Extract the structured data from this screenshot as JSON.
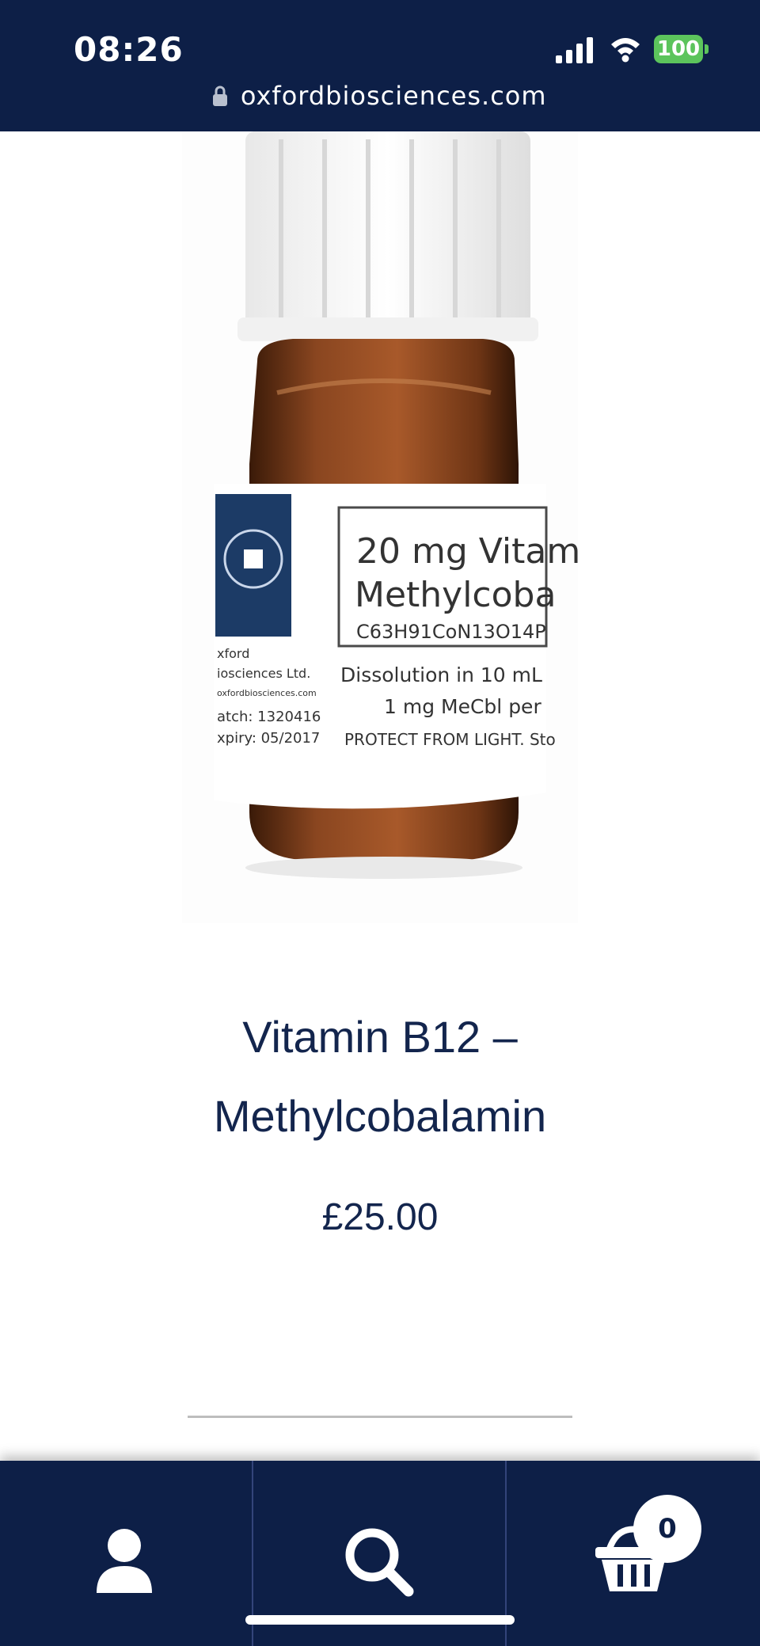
{
  "status_bar": {
    "time": "08:26",
    "battery": "100",
    "url": "oxfordbiosciences.com"
  },
  "product": {
    "title_line1": "Vitamin B12 –",
    "title_line2": "Methylcobalamin",
    "price": "£25.00",
    "image": {
      "label_line1": "20 mg Vitam",
      "label_line2": "Methylcoba",
      "formula": "C63H91CoN13O14P",
      "dissolution": "Dissolution in 10 mL",
      "concentration": "1 mg MeCbl per",
      "warning": "PROTECT FROM LIGHT. Sto",
      "company_line1": "xford",
      "company_line2": "iosciences Ltd.",
      "company_web": "oxfordbiosciences.com",
      "batch": "atch: 1320416",
      "expiry": "xpiry: 05/2017"
    }
  },
  "nav": {
    "account_icon": "user-icon",
    "search_icon": "search-icon",
    "cart_icon": "basket-icon",
    "cart_count": "0"
  },
  "colors": {
    "brand_navy": "#0d1f47",
    "text_navy": "#13254d",
    "battery_green": "#5cc45c"
  }
}
